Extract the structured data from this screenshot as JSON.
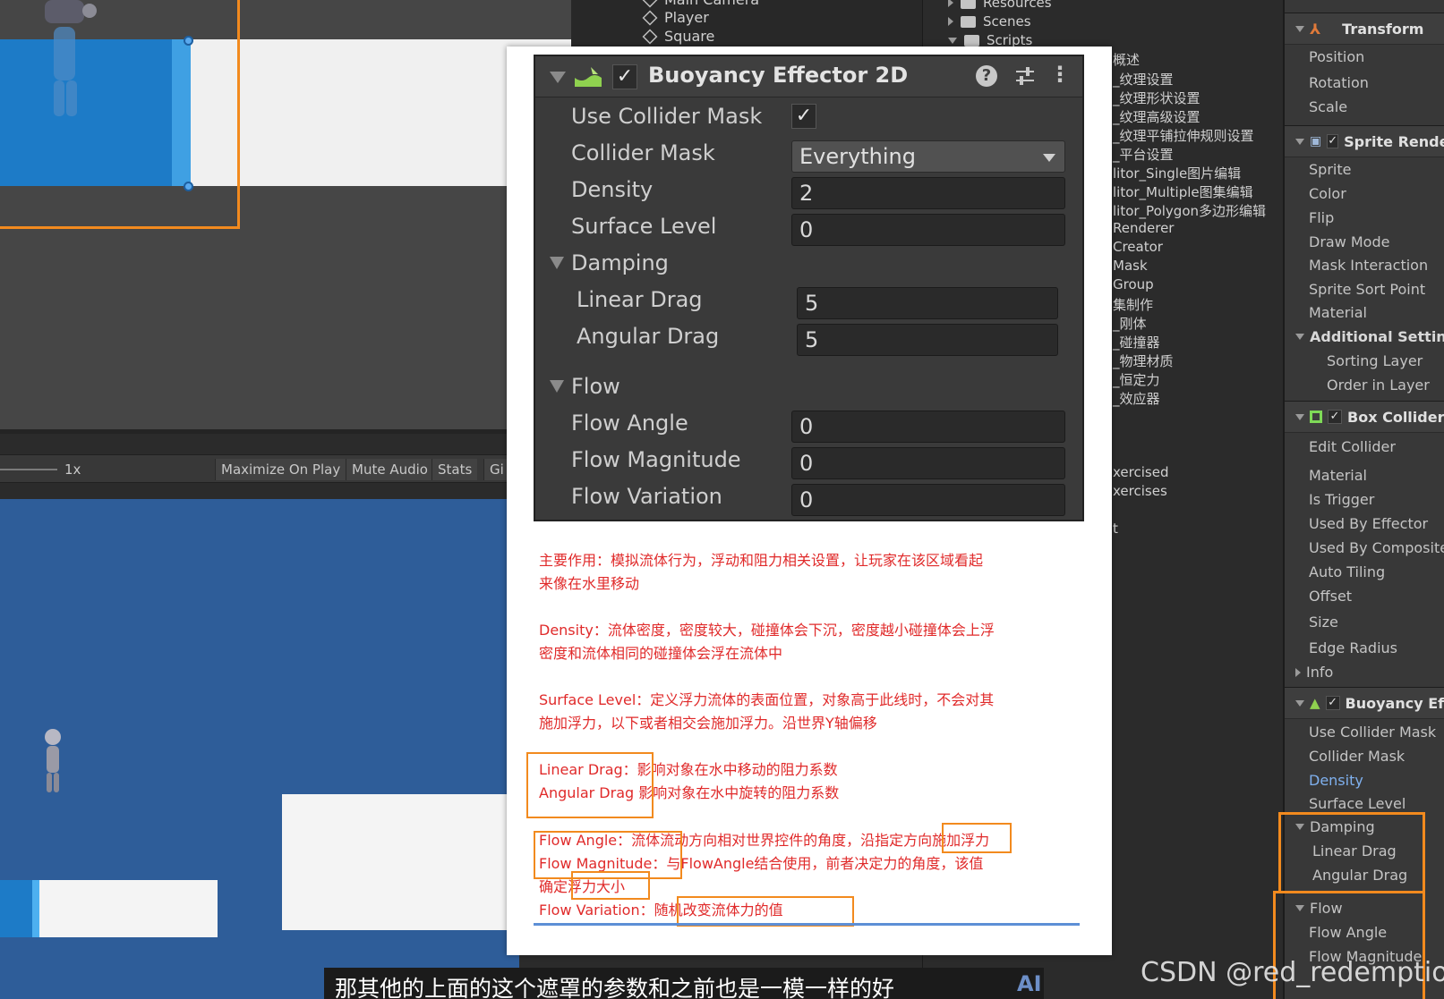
{
  "scene": {},
  "game_toolbar": {
    "zoom": "1x",
    "maximize_on_play": "Maximize On Play",
    "mute_audio": "Mute Audio",
    "stats": "Stats",
    "gizmos": "Gi"
  },
  "hierarchy": {
    "items": [
      "Main Camera",
      "Player",
      "Square"
    ]
  },
  "project": {
    "folders": [
      "Resources",
      "Scenes",
      "Scripts"
    ],
    "items": [
      "概述",
      "_纹理设置",
      "_纹理形状设置",
      "_纹理高级设置",
      "_纹理平铺拉伸规则设置",
      "_平台设置",
      "litor_Single图片编辑",
      "litor_Multiple图集编辑",
      "litor_Polygon多边形编辑",
      "Renderer",
      "Creator",
      "Mask",
      "Group",
      "集制作",
      "_刚体",
      "_碰撞器",
      "_物理材质",
      "_恒定力",
      "_效应器",
      "xercised",
      "xercises",
      "t"
    ]
  },
  "buoyancy_panel": {
    "title": "Buoyancy Effector 2D",
    "use_collider_mask_label": "Use Collider Mask",
    "use_collider_mask_checked": "✓",
    "collider_mask_label": "Collider Mask",
    "collider_mask_value": "Everything",
    "density_label": "Density",
    "density_value": "2",
    "surface_level_label": "Surface Level",
    "surface_level_value": "0",
    "damping_label": "Damping",
    "linear_drag_label": "Linear Drag",
    "linear_drag_value": "5",
    "angular_drag_label": "Angular Drag",
    "angular_drag_value": "5",
    "flow_label": "Flow",
    "flow_angle_label": "Flow Angle",
    "flow_angle_value": "0",
    "flow_magnitude_label": "Flow Magnitude",
    "flow_magnitude_value": "0",
    "flow_variation_label": "Flow Variation",
    "flow_variation_value": "0",
    "help_glyph": "?",
    "menu_glyph": "⋮"
  },
  "notes": {
    "main_1": "主要作用：模拟流体行为，浮动和阻力相关设置，让玩家在该区域看起",
    "main_2": "来像在水里移动",
    "density_1": "Density：流体密度，密度较大，碰撞体会下沉，密度越小碰撞体会上浮",
    "density_2": "密度和流体相同的碰撞体会浮在流体中",
    "surface_1": "Surface Level：定义浮力流体的表面位置，对象高于此线时，不会对其",
    "surface_2": "施加浮力，以下或者相交会施加浮力。沿世界Y轴偏移",
    "linear_drag": "Linear Drag：影响对象在水中移动的阻力系数",
    "angular_drag": "Angular Drag  影响对象在水中旋转的阻力系数",
    "flow_angle": "Flow Angle：流体流动方向相对世界控件的角度，沿指定方向施加浮力",
    "flow_magnitude_1": "Flow Magnitude：与FlowAngle结合使用，前者决定力的角度，该值",
    "flow_magnitude_2": "确定浮力大小",
    "flow_variation": "Flow Variation：随机改变流体力的值"
  },
  "inspector": {
    "transform": {
      "title": "Transform",
      "fields": [
        "Position",
        "Rotation",
        "Scale"
      ]
    },
    "sprite_renderer": {
      "title": "Sprite Rende",
      "fields": [
        "Sprite",
        "Color",
        "Flip",
        "Draw Mode",
        "Mask Interaction",
        "Sprite Sort Point",
        "Material"
      ],
      "additional_settings": "Additional Settings",
      "sub_fields": [
        "Sorting Layer",
        "Order in Layer"
      ]
    },
    "box_collider": {
      "title": "Box Collider",
      "fields": [
        "Edit Collider",
        "Material",
        "Is Trigger",
        "Used By Effector",
        "Used By Composite",
        "Auto Tiling",
        "Offset",
        "Size",
        "Edge Radius"
      ],
      "info": "Info"
    },
    "buoyancy": {
      "title": "Buoyancy Ef",
      "fields": [
        "Use Collider Mask",
        "Collider Mask",
        "Density",
        "Surface Level"
      ],
      "damping": "Damping",
      "damping_fields": [
        "Linear Drag",
        "Angular Drag"
      ],
      "flow": "Flow",
      "flow_fields": [
        "Flow Angle",
        "Flow Magnitude"
      ]
    }
  },
  "subtitle": {
    "text": "那其他的上面的这个遮罩的参数和之前也是一模一样的好",
    "ai_mark": "AI"
  },
  "watermark": "CSDN @red_redemption",
  "colors": {
    "note_red": "#e02a2a",
    "highlight_orange": "#f28a1e",
    "unity_blue": "#1d7bc7"
  }
}
